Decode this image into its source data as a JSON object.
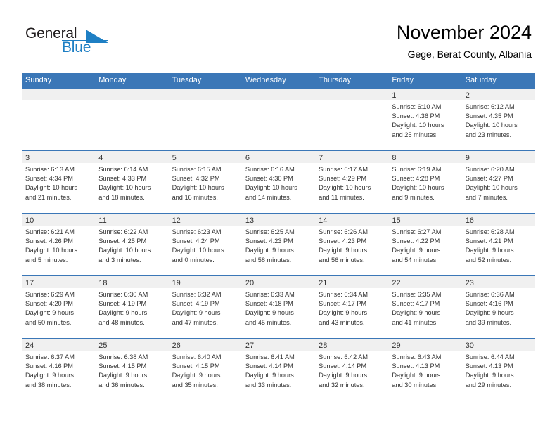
{
  "brand": {
    "name_part1": "General",
    "name_part2": "Blue",
    "accent_color": "#1e7fc4"
  },
  "header": {
    "title": "November 2024",
    "subtitle": "Gege, Berat County, Albania"
  },
  "theme": {
    "header_blue": "#3b77b7",
    "date_strip_gray": "#f0f0f0",
    "text_color": "#333333"
  },
  "weekdays": [
    "Sunday",
    "Monday",
    "Tuesday",
    "Wednesday",
    "Thursday",
    "Friday",
    "Saturday"
  ],
  "weeks": [
    [
      {
        "date": "",
        "sunrise": "",
        "sunset": "",
        "daylight_line1": "",
        "daylight_line2": ""
      },
      {
        "date": "",
        "sunrise": "",
        "sunset": "",
        "daylight_line1": "",
        "daylight_line2": ""
      },
      {
        "date": "",
        "sunrise": "",
        "sunset": "",
        "daylight_line1": "",
        "daylight_line2": ""
      },
      {
        "date": "",
        "sunrise": "",
        "sunset": "",
        "daylight_line1": "",
        "daylight_line2": ""
      },
      {
        "date": "",
        "sunrise": "",
        "sunset": "",
        "daylight_line1": "",
        "daylight_line2": ""
      },
      {
        "date": "1",
        "sunrise": "Sunrise: 6:10 AM",
        "sunset": "Sunset: 4:36 PM",
        "daylight_line1": "Daylight: 10 hours",
        "daylight_line2": "and 25 minutes."
      },
      {
        "date": "2",
        "sunrise": "Sunrise: 6:12 AM",
        "sunset": "Sunset: 4:35 PM",
        "daylight_line1": "Daylight: 10 hours",
        "daylight_line2": "and 23 minutes."
      }
    ],
    [
      {
        "date": "3",
        "sunrise": "Sunrise: 6:13 AM",
        "sunset": "Sunset: 4:34 PM",
        "daylight_line1": "Daylight: 10 hours",
        "daylight_line2": "and 21 minutes."
      },
      {
        "date": "4",
        "sunrise": "Sunrise: 6:14 AM",
        "sunset": "Sunset: 4:33 PM",
        "daylight_line1": "Daylight: 10 hours",
        "daylight_line2": "and 18 minutes."
      },
      {
        "date": "5",
        "sunrise": "Sunrise: 6:15 AM",
        "sunset": "Sunset: 4:32 PM",
        "daylight_line1": "Daylight: 10 hours",
        "daylight_line2": "and 16 minutes."
      },
      {
        "date": "6",
        "sunrise": "Sunrise: 6:16 AM",
        "sunset": "Sunset: 4:30 PM",
        "daylight_line1": "Daylight: 10 hours",
        "daylight_line2": "and 14 minutes."
      },
      {
        "date": "7",
        "sunrise": "Sunrise: 6:17 AM",
        "sunset": "Sunset: 4:29 PM",
        "daylight_line1": "Daylight: 10 hours",
        "daylight_line2": "and 11 minutes."
      },
      {
        "date": "8",
        "sunrise": "Sunrise: 6:19 AM",
        "sunset": "Sunset: 4:28 PM",
        "daylight_line1": "Daylight: 10 hours",
        "daylight_line2": "and 9 minutes."
      },
      {
        "date": "9",
        "sunrise": "Sunrise: 6:20 AM",
        "sunset": "Sunset: 4:27 PM",
        "daylight_line1": "Daylight: 10 hours",
        "daylight_line2": "and 7 minutes."
      }
    ],
    [
      {
        "date": "10",
        "sunrise": "Sunrise: 6:21 AM",
        "sunset": "Sunset: 4:26 PM",
        "daylight_line1": "Daylight: 10 hours",
        "daylight_line2": "and 5 minutes."
      },
      {
        "date": "11",
        "sunrise": "Sunrise: 6:22 AM",
        "sunset": "Sunset: 4:25 PM",
        "daylight_line1": "Daylight: 10 hours",
        "daylight_line2": "and 3 minutes."
      },
      {
        "date": "12",
        "sunrise": "Sunrise: 6:23 AM",
        "sunset": "Sunset: 4:24 PM",
        "daylight_line1": "Daylight: 10 hours",
        "daylight_line2": "and 0 minutes."
      },
      {
        "date": "13",
        "sunrise": "Sunrise: 6:25 AM",
        "sunset": "Sunset: 4:23 PM",
        "daylight_line1": "Daylight: 9 hours",
        "daylight_line2": "and 58 minutes."
      },
      {
        "date": "14",
        "sunrise": "Sunrise: 6:26 AM",
        "sunset": "Sunset: 4:23 PM",
        "daylight_line1": "Daylight: 9 hours",
        "daylight_line2": "and 56 minutes."
      },
      {
        "date": "15",
        "sunrise": "Sunrise: 6:27 AM",
        "sunset": "Sunset: 4:22 PM",
        "daylight_line1": "Daylight: 9 hours",
        "daylight_line2": "and 54 minutes."
      },
      {
        "date": "16",
        "sunrise": "Sunrise: 6:28 AM",
        "sunset": "Sunset: 4:21 PM",
        "daylight_line1": "Daylight: 9 hours",
        "daylight_line2": "and 52 minutes."
      }
    ],
    [
      {
        "date": "17",
        "sunrise": "Sunrise: 6:29 AM",
        "sunset": "Sunset: 4:20 PM",
        "daylight_line1": "Daylight: 9 hours",
        "daylight_line2": "and 50 minutes."
      },
      {
        "date": "18",
        "sunrise": "Sunrise: 6:30 AM",
        "sunset": "Sunset: 4:19 PM",
        "daylight_line1": "Daylight: 9 hours",
        "daylight_line2": "and 48 minutes."
      },
      {
        "date": "19",
        "sunrise": "Sunrise: 6:32 AM",
        "sunset": "Sunset: 4:19 PM",
        "daylight_line1": "Daylight: 9 hours",
        "daylight_line2": "and 47 minutes."
      },
      {
        "date": "20",
        "sunrise": "Sunrise: 6:33 AM",
        "sunset": "Sunset: 4:18 PM",
        "daylight_line1": "Daylight: 9 hours",
        "daylight_line2": "and 45 minutes."
      },
      {
        "date": "21",
        "sunrise": "Sunrise: 6:34 AM",
        "sunset": "Sunset: 4:17 PM",
        "daylight_line1": "Daylight: 9 hours",
        "daylight_line2": "and 43 minutes."
      },
      {
        "date": "22",
        "sunrise": "Sunrise: 6:35 AM",
        "sunset": "Sunset: 4:17 PM",
        "daylight_line1": "Daylight: 9 hours",
        "daylight_line2": "and 41 minutes."
      },
      {
        "date": "23",
        "sunrise": "Sunrise: 6:36 AM",
        "sunset": "Sunset: 4:16 PM",
        "daylight_line1": "Daylight: 9 hours",
        "daylight_line2": "and 39 minutes."
      }
    ],
    [
      {
        "date": "24",
        "sunrise": "Sunrise: 6:37 AM",
        "sunset": "Sunset: 4:16 PM",
        "daylight_line1": "Daylight: 9 hours",
        "daylight_line2": "and 38 minutes."
      },
      {
        "date": "25",
        "sunrise": "Sunrise: 6:38 AM",
        "sunset": "Sunset: 4:15 PM",
        "daylight_line1": "Daylight: 9 hours",
        "daylight_line2": "and 36 minutes."
      },
      {
        "date": "26",
        "sunrise": "Sunrise: 6:40 AM",
        "sunset": "Sunset: 4:15 PM",
        "daylight_line1": "Daylight: 9 hours",
        "daylight_line2": "and 35 minutes."
      },
      {
        "date": "27",
        "sunrise": "Sunrise: 6:41 AM",
        "sunset": "Sunset: 4:14 PM",
        "daylight_line1": "Daylight: 9 hours",
        "daylight_line2": "and 33 minutes."
      },
      {
        "date": "28",
        "sunrise": "Sunrise: 6:42 AM",
        "sunset": "Sunset: 4:14 PM",
        "daylight_line1": "Daylight: 9 hours",
        "daylight_line2": "and 32 minutes."
      },
      {
        "date": "29",
        "sunrise": "Sunrise: 6:43 AM",
        "sunset": "Sunset: 4:13 PM",
        "daylight_line1": "Daylight: 9 hours",
        "daylight_line2": "and 30 minutes."
      },
      {
        "date": "30",
        "sunrise": "Sunrise: 6:44 AM",
        "sunset": "Sunset: 4:13 PM",
        "daylight_line1": "Daylight: 9 hours",
        "daylight_line2": "and 29 minutes."
      }
    ]
  ]
}
